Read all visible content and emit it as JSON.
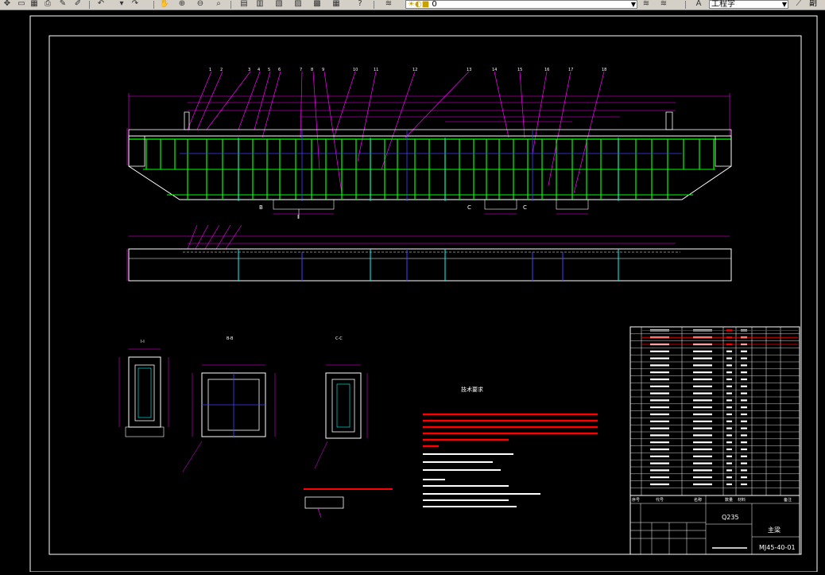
{
  "toolbar": {
    "layer_value": "0",
    "text_style_value": "工程字",
    "right_label": "副",
    "icons": [
      "pan-icon",
      "open-icon",
      "save-icon",
      "print-icon",
      "match-icon",
      "undo-icon",
      "redo-icon",
      "zoom-realtime-icon",
      "zoom-window-icon",
      "zoom-previous-icon",
      "zoom-extents-icon",
      "properties-icon",
      "design-center-icon",
      "tool-palette-icon",
      "sheet-set-icon",
      "markup-icon",
      "calculator-icon",
      "help-icon",
      "layer-manager-icon",
      "layer-state-icon",
      "text-style-icon"
    ]
  },
  "drawing": {
    "section_labels": [
      "I-I",
      "B-B",
      "C-C"
    ],
    "view_markers": [
      "B",
      "C",
      "C",
      "I"
    ],
    "tech_title": "技术要求",
    "tech_lines_red": 6,
    "title_block": {
      "material": "Q235",
      "name": "主梁",
      "drawing_no": "MJ45-40-01"
    },
    "bom_header": [
      "序号",
      "代号",
      "名称",
      "数量",
      "材料",
      "备注"
    ]
  }
}
